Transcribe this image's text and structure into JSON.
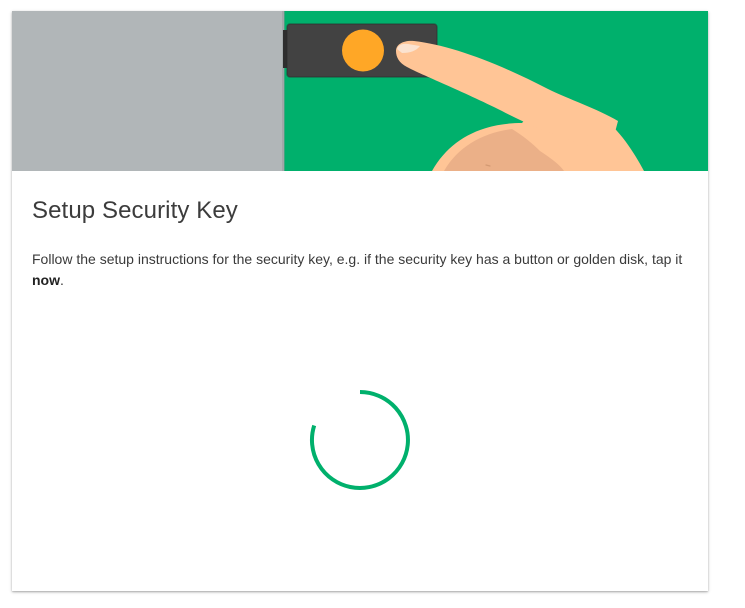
{
  "dialog": {
    "title": "Setup Security Key",
    "instructions_prefix": "Follow the setup instructions for the security key, e.g. if the security key has a button or golden disk, tap it ",
    "instructions_emphasis": "now",
    "instructions_suffix": "."
  },
  "illustration": {
    "icon": "security-key-tap-illustration",
    "colors": {
      "left_panel": "#b1b6b8",
      "right_panel": "#00b06c",
      "key_body": "#424242",
      "key_disk": "#ffa726",
      "skin": "#ffc596",
      "skin_shadow": "#ebb088"
    }
  },
  "spinner": {
    "icon": "loading-spinner-icon",
    "color": "#00b06c"
  }
}
